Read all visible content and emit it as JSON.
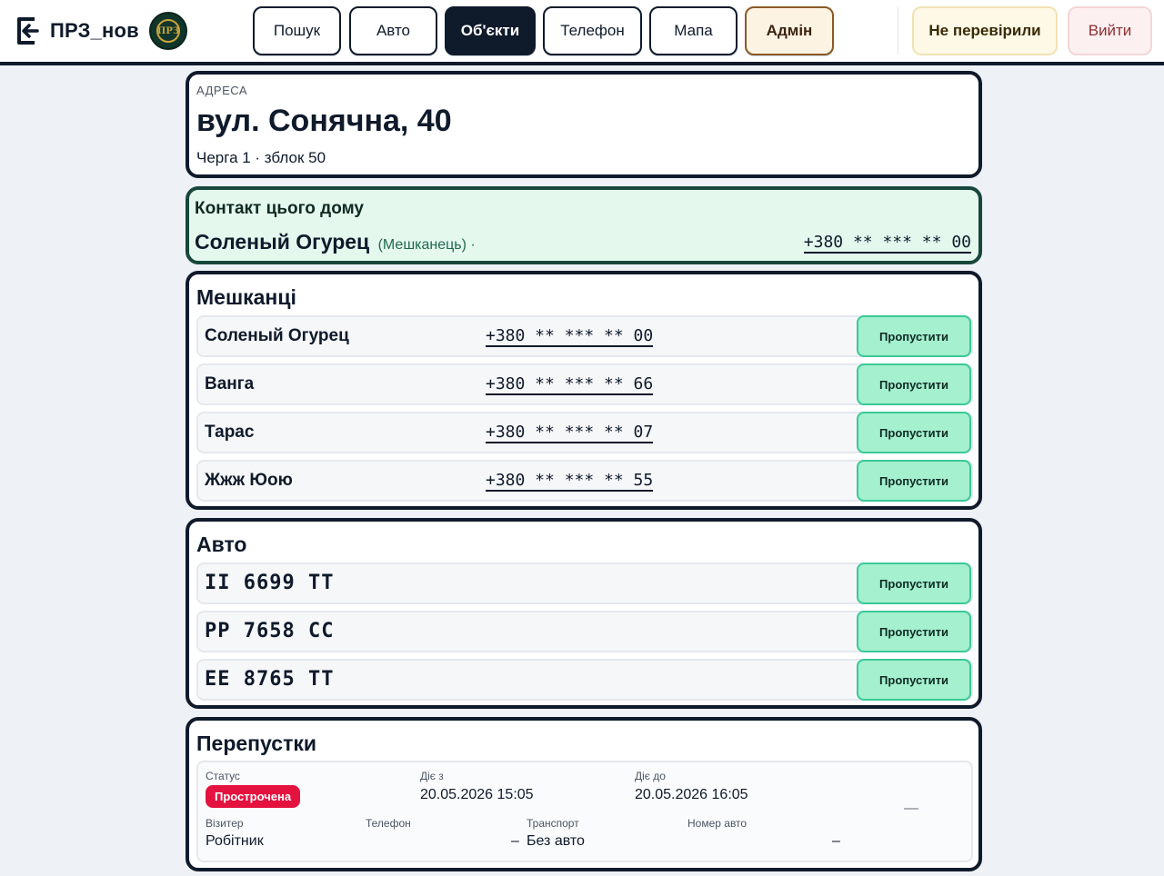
{
  "header": {
    "app_title": "ПРЗ_нов",
    "emblem_text": "ПРЗ",
    "nav": [
      {
        "label": "Пошук"
      },
      {
        "label": "Авто"
      },
      {
        "label": "Об'єкти"
      },
      {
        "label": "Телефон"
      },
      {
        "label": "Мапа"
      },
      {
        "label": "Адмін"
      }
    ],
    "active_tab": "Об'єкти",
    "unchecked_label": "Не перевірили",
    "logout_label": "Вийти"
  },
  "address": {
    "caption": "АДРЕСА",
    "street": "вул. Сонячна, 40",
    "meta": "Черга 1 · зблок 50"
  },
  "contact": {
    "title": "Контакт цього дому",
    "name": "Соленый Огурец",
    "role": "(Мешканець) ·",
    "phone": "+380 ** *** ** 00"
  },
  "residents": {
    "title": "Мешканці",
    "skip_label": "Пропустити",
    "items": [
      {
        "name": "Соленый Огурец",
        "phone": "+380 ** *** ** 00"
      },
      {
        "name": "Ванга",
        "phone": "+380 ** *** ** 66"
      },
      {
        "name": "Тарас",
        "phone": "+380 ** *** ** 07"
      },
      {
        "name": "Жжж Юою",
        "phone": "+380 ** *** ** 55"
      }
    ]
  },
  "cars": {
    "title": "Авто",
    "skip_label": "Пропустити",
    "items": [
      {
        "plate": "II 6699 TT"
      },
      {
        "plate": "PP 7658 CC"
      },
      {
        "plate": "EE 8765 TT"
      }
    ]
  },
  "passes": {
    "title": "Перепустки",
    "status_label": "Статус",
    "status_value": "Прострочена",
    "status_color": "#e3123f",
    "from_label": "Діє з",
    "from_value": "20.05.2026 15:05",
    "to_label": "Діє до",
    "to_value": "20.05.2026 16:05",
    "extra_value": "—",
    "visitor_label": "Візитер",
    "visitor_value": "Робітник",
    "phone_label": "Телефон",
    "phone_value": "–",
    "transport_label": "Транспорт",
    "transport_value": "Без авто",
    "plate_label": "Номер авто",
    "plate_value": "–"
  },
  "colors": {
    "primary": "#0f1a2b",
    "accent_green": "#a4f0cf",
    "contact_bg": "#e4f8ee",
    "expired": "#e3123f"
  }
}
